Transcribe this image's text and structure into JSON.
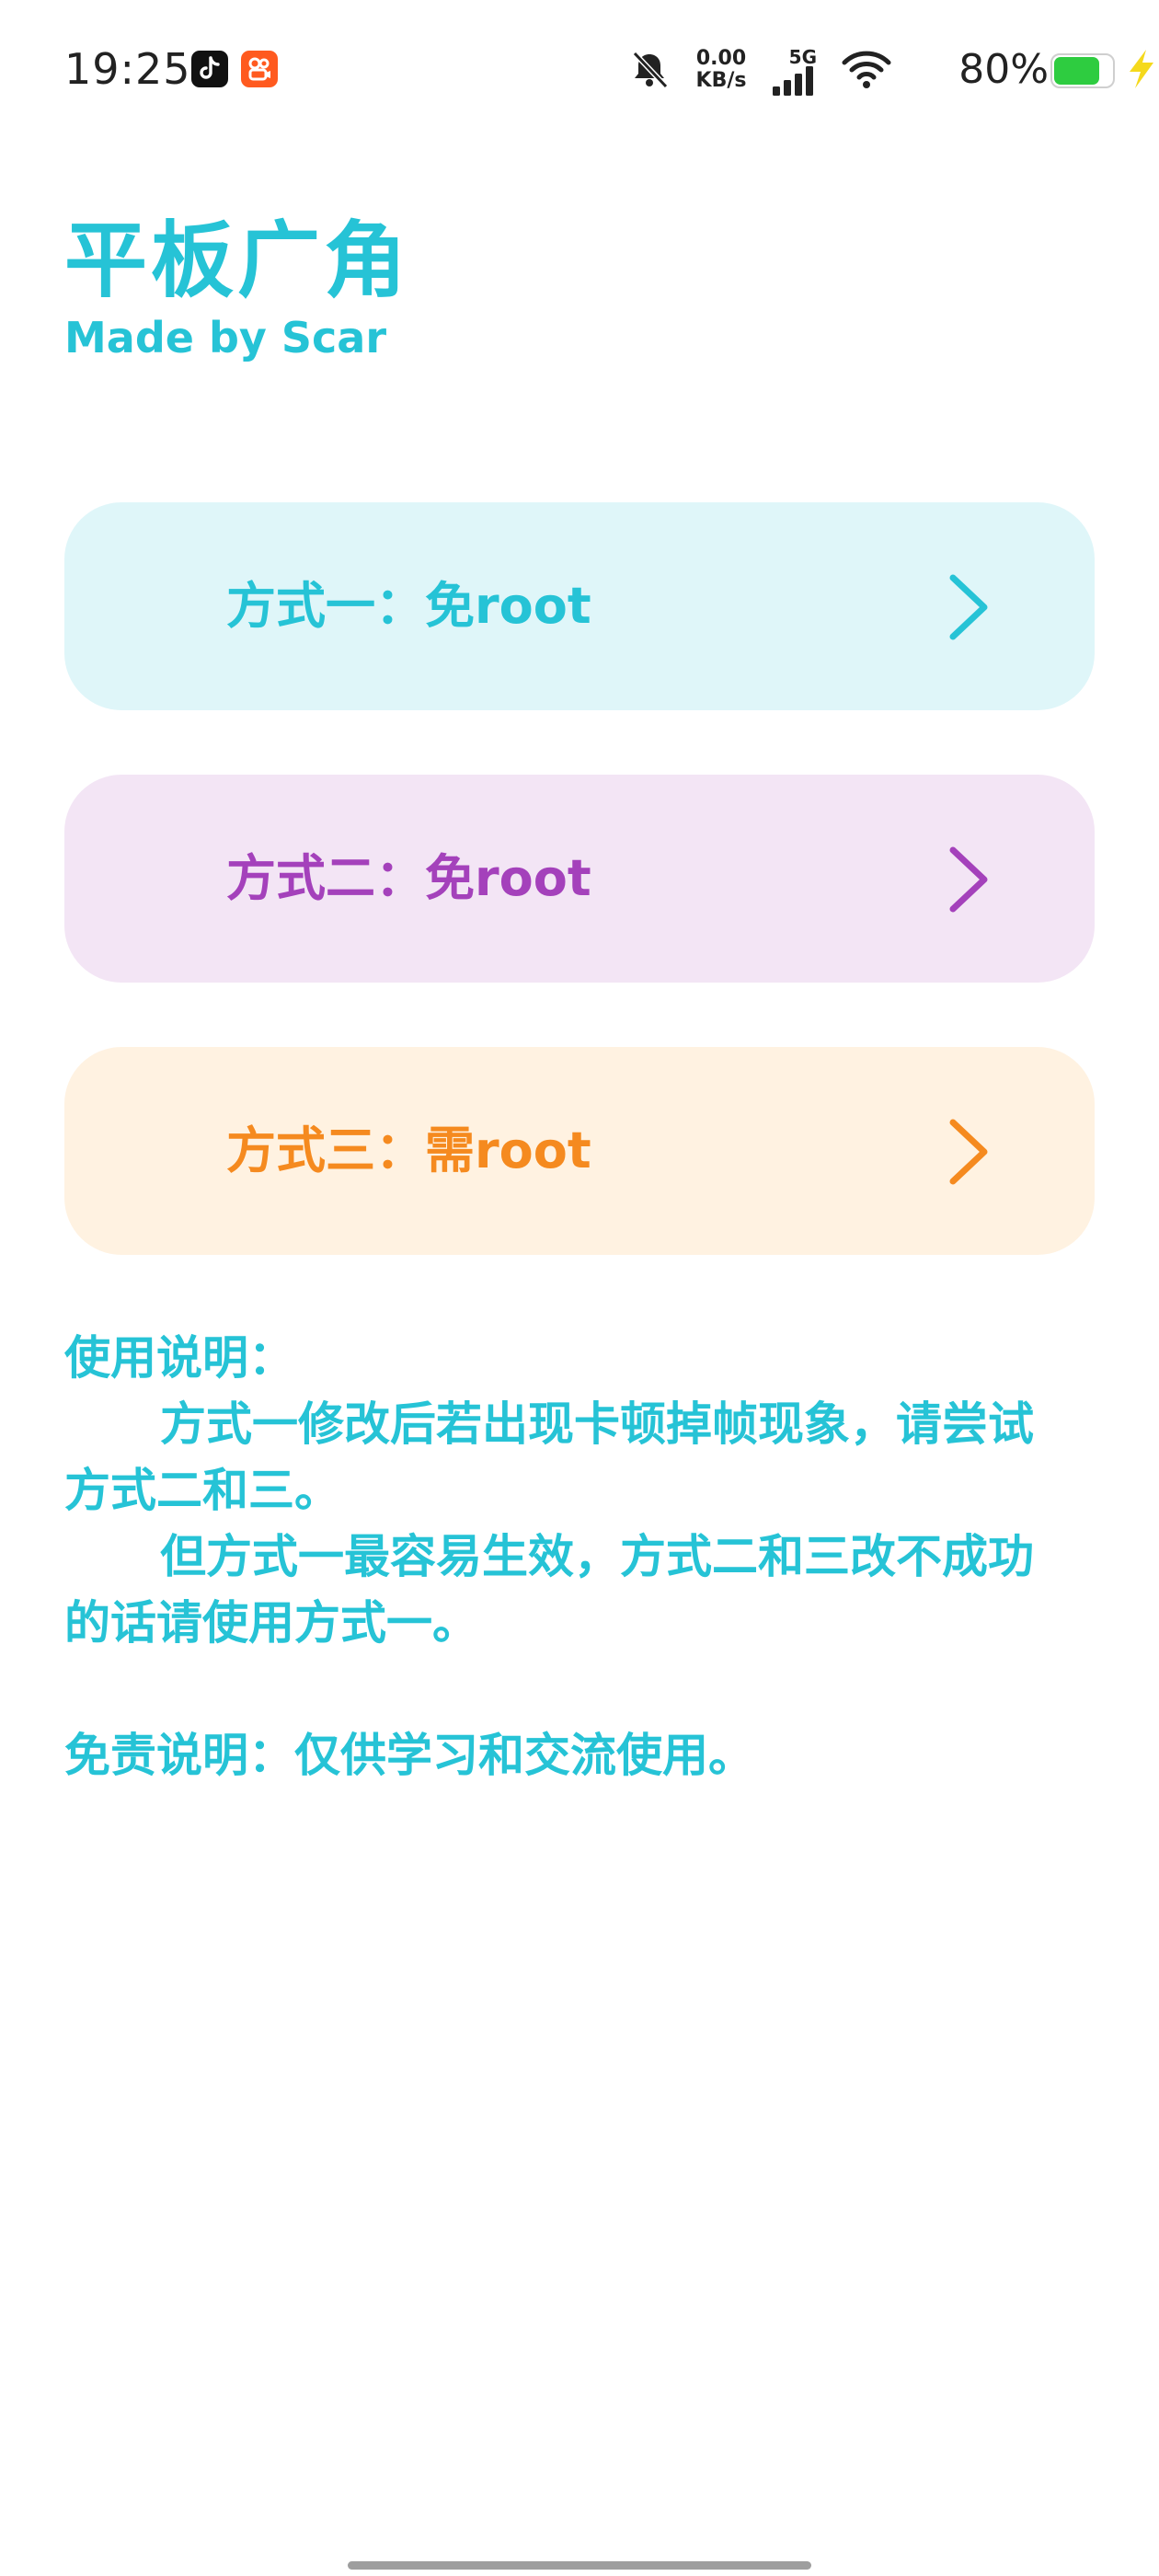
{
  "status_bar": {
    "time": "19:25",
    "net_speed_value": "0.00",
    "net_speed_unit": "KB/s",
    "network_type": "5G",
    "battery_percent": "80%",
    "battery_level": 0.8,
    "icons": [
      "tiktok-app-icon",
      "kuaishou-app-icon",
      "bell-muted-icon",
      "signal-icon",
      "wifi-icon",
      "battery-icon",
      "charging-bolt-icon"
    ]
  },
  "header": {
    "title": "平板广角",
    "subtitle": "Made by Scar"
  },
  "methods": [
    {
      "label": "方式一：免root",
      "color": "#26c3d6",
      "background": "#dff6f9"
    },
    {
      "label": "方式二：免root",
      "color": "#a441bb",
      "background": "#f3e5f5"
    },
    {
      "label": "方式三：需root",
      "color": "#f58a1f",
      "background": "#fff2e1"
    }
  ],
  "usage": {
    "heading": "使用说明：",
    "paragraph1": "方式一修改后若出现卡顿掉帧现象，请尝试方式二和三。",
    "paragraph2": "但方式一最容易生效，方式二和三改不成功的话请使用方式一。"
  },
  "disclaimer": "免责说明：仅供学习和交流使用。"
}
